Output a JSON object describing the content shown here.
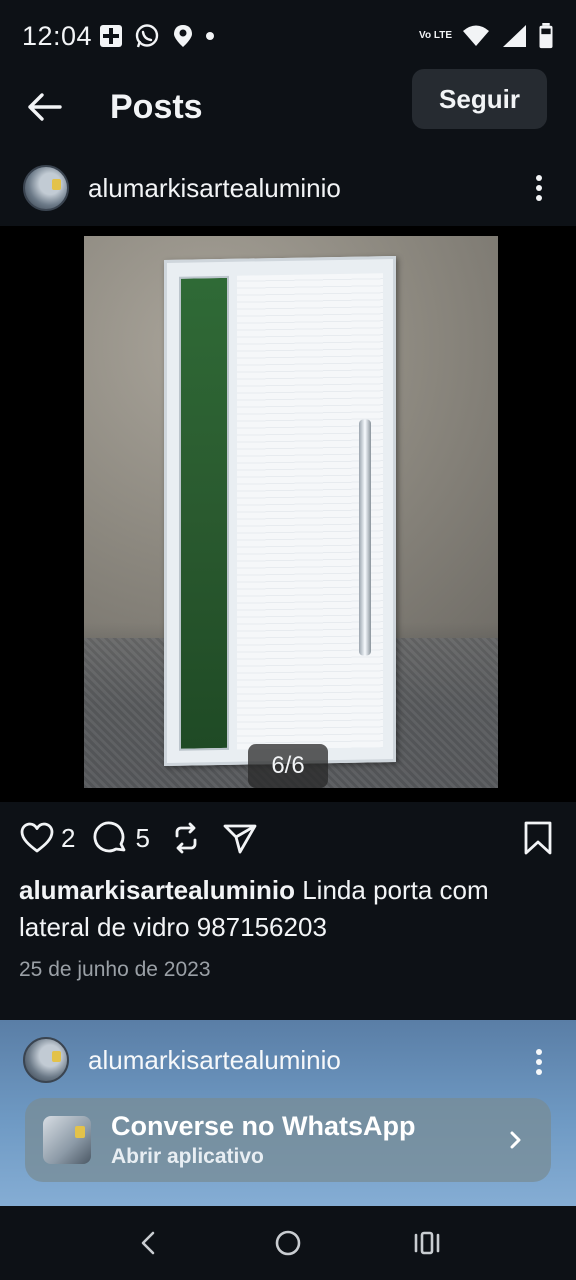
{
  "status_bar": {
    "time": "12:04",
    "network": "Vo LTE"
  },
  "header": {
    "title": "Posts",
    "follow_label": "Seguir"
  },
  "post": {
    "username": "alumarkisartealuminio",
    "media_counter": "6/6",
    "likes": "2",
    "comments": "5",
    "caption_user": "alumarkisartealuminio",
    "caption_text": " Linda porta com lateral de vidro 987156203",
    "date": "25 de junho de 2023"
  },
  "promo": {
    "username": "alumarkisartealuminio",
    "cta_title": "Converse no WhatsApp",
    "cta_subtitle": "Abrir aplicativo"
  },
  "colors": {
    "background": "#0d1116",
    "text": "#f2f4f6",
    "muted": "#9aa0a6",
    "button_bg": "#262b31",
    "promo_bg": "#6f9ac4"
  },
  "icons": {
    "back": "arrow-left-icon",
    "more": "more-vertical-icon",
    "like": "heart-icon",
    "comment": "comment-icon",
    "repost": "repost-icon",
    "share": "send-icon",
    "save": "bookmark-icon",
    "chevron": "chevron-right-icon"
  }
}
